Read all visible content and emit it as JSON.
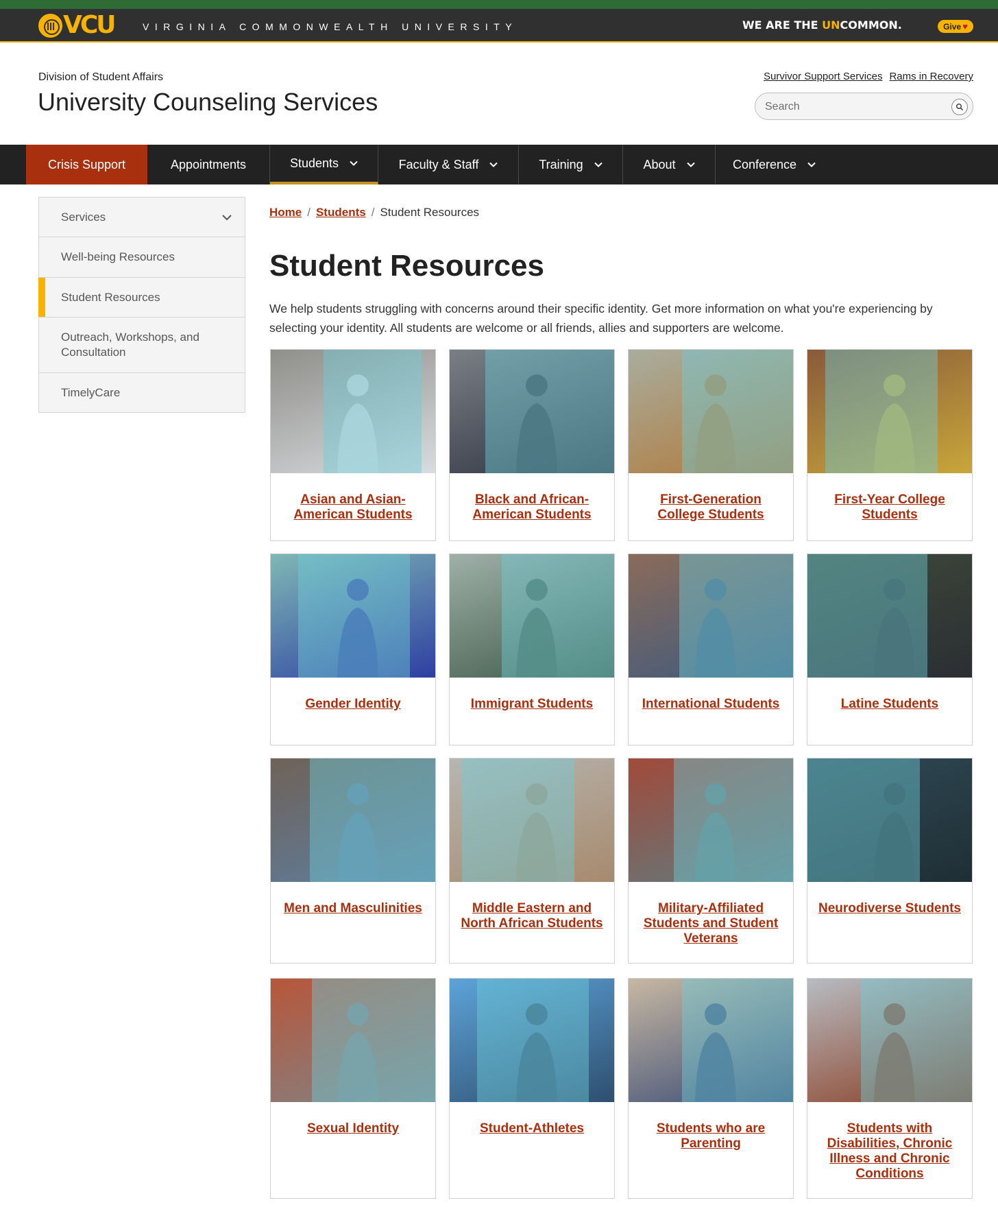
{
  "brand": {
    "logo_text": "VCU",
    "university_name": "VIRGINIA COMMONWEALTH UNIVERSITY",
    "tagline_before": "WE ARE THE ",
    "tagline_highlight": "UN",
    "tagline_after": "COMMON.",
    "give_label": "Give",
    "colors": {
      "gold": "#f8b300",
      "green": "#2f6b34",
      "dark": "#303030",
      "crisis": "#a8300e",
      "link": "#a8300e"
    }
  },
  "header": {
    "division": "Division of Student Affairs",
    "site_title": "University Counseling Services",
    "util_links": [
      "Survivor Support Services",
      "Rams in Recovery"
    ],
    "search": {
      "placeholder": "Search",
      "icon": "search-icon"
    }
  },
  "nav": {
    "items": [
      {
        "label": "Crisis Support",
        "dropdown": false
      },
      {
        "label": "Appointments",
        "dropdown": false
      },
      {
        "label": "Students",
        "dropdown": true,
        "active": true
      },
      {
        "label": "Faculty & Staff",
        "dropdown": true
      },
      {
        "label": "Training",
        "dropdown": true
      },
      {
        "label": "About",
        "dropdown": true
      },
      {
        "label": "Conference",
        "dropdown": true
      }
    ]
  },
  "sidebar": {
    "items": [
      {
        "label": "Services",
        "dropdown": true
      },
      {
        "label": "Well-being Resources"
      },
      {
        "label": "Student Resources",
        "current": true
      },
      {
        "label": "Outreach, Workshops, and Consultation"
      },
      {
        "label": "TimelyCare"
      }
    ]
  },
  "breadcrumb": {
    "home": "Home",
    "section": "Students",
    "current": "Student Resources",
    "separator": "/"
  },
  "main": {
    "title": "Student Resources",
    "intro": "We help students struggling with concerns around their specific identity. Get more information on what you're experiencing by selecting your identity. All students are welcome or all friends, allies and supporters are welcome."
  },
  "cards": [
    {
      "label": "Asian and Asian-American Students",
      "bg": "#8f8f8a",
      "accent": "#d9dce0"
    },
    {
      "label": "Black and African-American Students",
      "bg": "#7a7f86",
      "accent": "#2f3340"
    },
    {
      "label": "First-Generation College Students",
      "bg": "#a9ad9e",
      "accent": "#b07a3b"
    },
    {
      "label": "First-Year College Students",
      "bg": "#8a5a3a",
      "accent": "#c9a63a"
    },
    {
      "label": "Gender Identity",
      "bg": "#7fb8b5",
      "accent": "#2d3fa2"
    },
    {
      "label": "Immigrant Students",
      "bg": "#9fb0a8",
      "accent": "#3f5a48"
    },
    {
      "label": "International Students",
      "bg": "#8b6b5a",
      "accent": "#3d5a7d"
    },
    {
      "label": "Latine Students",
      "bg": "#3e4a3a",
      "accent": "#2b2e33"
    },
    {
      "label": "Men and Masculinities",
      "bg": "#6f6258",
      "accent": "#5e7ea0"
    },
    {
      "label": "Middle Eastern and North African Students",
      "bg": "#b7b6b2",
      "accent": "#a78a6d"
    },
    {
      "label": "Military-Affiliated Students and Student Veterans",
      "bg": "#a14a3a",
      "accent": "#5e7c80"
    },
    {
      "label": "Neurodiverse Students",
      "bg": "#2f4a55",
      "accent": "#1f2e35"
    },
    {
      "label": "Sexual Identity",
      "bg": "#b8563a",
      "accent": "#7f8487"
    },
    {
      "label": "Student-Athletes",
      "bg": "#5da3d8",
      "accent": "#2e4f6f"
    },
    {
      "label": "Students who are Parenting",
      "bg": "#c7b8a2",
      "accent": "#3a4b75"
    },
    {
      "label": "Students with Disabilities, Chronic Illness and Chronic Conditions",
      "bg": "#b7bcc2",
      "accent": "#8a3d22"
    }
  ]
}
